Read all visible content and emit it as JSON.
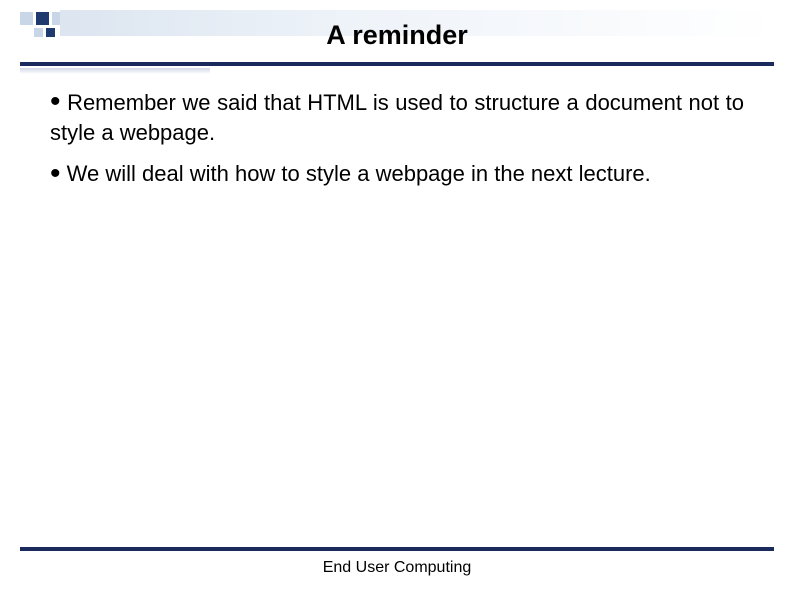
{
  "slide": {
    "title": "A reminder",
    "bullets": [
      "Remember we said that HTML is used to structure a document not to style a webpage.",
      "We will deal with how to style a webpage in the next lecture."
    ],
    "footer": "End User Computing"
  }
}
